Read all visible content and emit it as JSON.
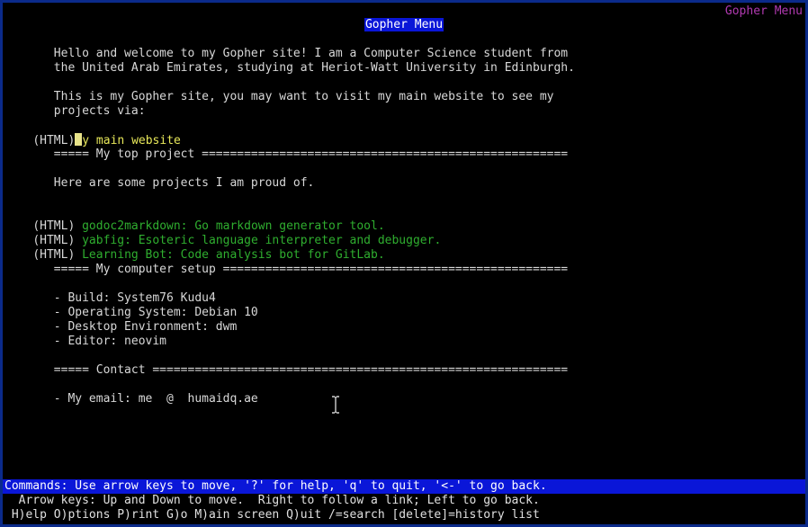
{
  "window": {
    "menu_title": "Gopher Menu",
    "corner_title": "Gopher Menu"
  },
  "content": {
    "intro_1": "       Hello and welcome to my Gopher site! I am a Computer Science student from",
    "intro_2": "       the United Arab Emirates, studying at Heriot-Watt University in Edinburgh.",
    "visit_1": "       This is my Gopher site, you may want to visit my main website to see my",
    "visit_2": "       projects via:",
    "main_link_prefix": "(HTML)",
    "main_link_label": "y main website",
    "top_project_header": "       ===== My top project ====================================================",
    "proud_text": "       Here are some projects I am proud of.",
    "projects": [
      {
        "prefix": "(HTML) ",
        "label": "godoc2markdown: Go markdown generator tool."
      },
      {
        "prefix": "(HTML) ",
        "label": "yabfig: Esoteric language interpreter and debugger."
      },
      {
        "prefix": "(HTML) ",
        "label": "Learning Bot: Code analysis bot for GitLab."
      }
    ],
    "setup_header": "       ===== My computer setup =================================================",
    "setup_items": [
      "       - Build: System76 Kudu4",
      "       - Operating System: Debian 10",
      "       - Desktop Environment: dwm",
      "       - Editor: neovim"
    ],
    "contact_header": "       ===== Contact ===========================================================",
    "email_line": "       - My email: me  @  humaidq.ae"
  },
  "footer": {
    "commands": "Commands: Use arrow keys to move, '?' for help, 'q' to quit, '<-' to go back.",
    "arrow_help": "  Arrow keys: Up and Down to move.  Right to follow a link; Left to go back.",
    "key_help": " H)elp O)ptions P)rint G)o M)ain screen Q)uit /=search [delete]=history list"
  },
  "colors": {
    "selected_link": "#e8e85a",
    "link": "#2fae2f",
    "highlight_bar": "#0a16d8",
    "corner_title": "#b23ab2"
  },
  "icons": {
    "mouse_cursor": "text-ibeam-cursor-icon"
  }
}
